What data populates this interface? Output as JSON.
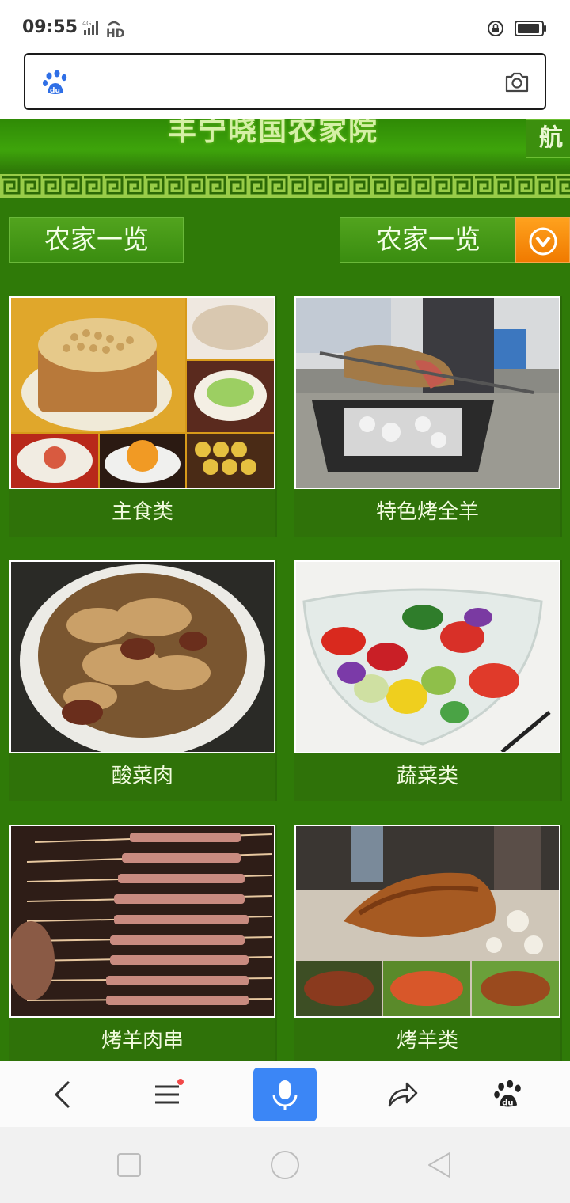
{
  "status": {
    "time": "09:55",
    "network": "4G",
    "hd": "HD"
  },
  "search": {
    "placeholder": ""
  },
  "site": {
    "title": "丰宁晓国农家院",
    "nav_char": "航"
  },
  "buttons": {
    "left": "农家一览",
    "right": "农家一览"
  },
  "cards": [
    {
      "label": "主食类",
      "icon": "staple-food-photo"
    },
    {
      "label": "特色烤全羊",
      "icon": "roast-whole-lamb-photo"
    },
    {
      "label": "酸菜肉",
      "icon": "pickled-cabbage-pork-photo"
    },
    {
      "label": "蔬菜类",
      "icon": "vegetable-salad-photo"
    },
    {
      "label": "烤羊肉串",
      "icon": "lamb-skewers-photo"
    },
    {
      "label": "烤羊类",
      "icon": "roast-lamb-photo"
    }
  ],
  "bottom_bar": {
    "items": [
      "back",
      "menu",
      "voice",
      "share",
      "baidu"
    ]
  },
  "colors": {
    "page_bg": "#2f7a08",
    "accent_orange": "#f07a00",
    "mic_blue": "#3b86f6"
  }
}
